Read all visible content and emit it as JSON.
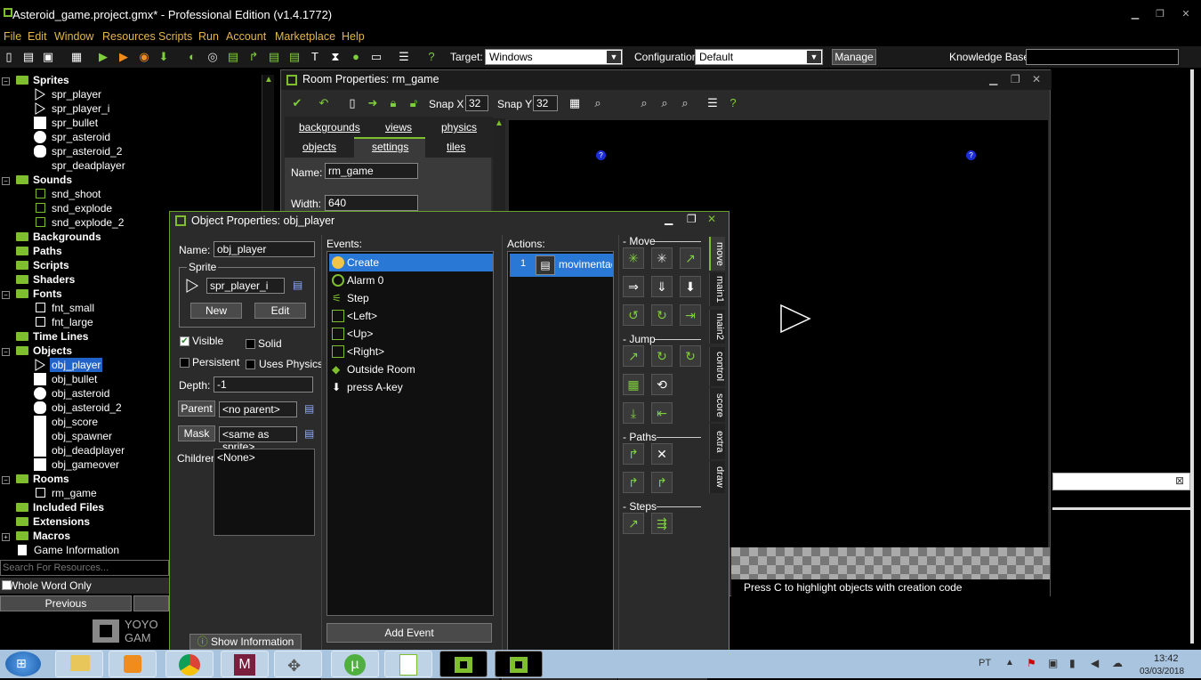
{
  "app": {
    "title": "Asteroid_game.project.gmx*  -  Professional Edition (v1.4.1772)",
    "win_minimize": "▁",
    "win_restore": "❐",
    "win_close": "✕"
  },
  "menu": [
    "File",
    "Edit",
    "Window",
    "Resources",
    "Scripts",
    "Run",
    "Account",
    "Marketplace",
    "Help"
  ],
  "toolbar": {
    "target_label": "Target:",
    "target_value": "Windows",
    "config_label": "Configuration:",
    "config_value": "Default",
    "manage_label": "Manage",
    "kb_label": "Knowledge Base:",
    "kb_value": ""
  },
  "tree": {
    "sprites": {
      "label": "Sprites",
      "items": [
        "spr_player",
        "spr_player_i",
        "spr_bullet",
        "spr_asteroid",
        "spr_asteroid_2",
        "spr_deadplayer"
      ]
    },
    "sounds": {
      "label": "Sounds",
      "items": [
        "snd_shoot",
        "snd_explode",
        "snd_explode_2"
      ]
    },
    "backgrounds": "Backgrounds",
    "paths": "Paths",
    "scripts": "Scripts",
    "shaders": "Shaders",
    "fonts": {
      "label": "Fonts",
      "items": [
        "fnt_small",
        "fnt_large"
      ]
    },
    "timelines": "Time Lines",
    "objects": {
      "label": "Objects",
      "items": [
        "obj_player",
        "obj_bullet",
        "obj_asteroid",
        "obj_asteroid_2",
        "obj_score",
        "obj_spawner",
        "obj_deadplayer",
        "obj_gameover"
      ]
    },
    "rooms": {
      "label": "Rooms",
      "items": [
        "rm_game"
      ]
    },
    "included": "Included Files",
    "extensions": "Extensions",
    "macros": "Macros",
    "gameinfo": "Game Information",
    "search_placeholder": "Search For Resources...",
    "whole_word": "Whole Word Only",
    "previous": "Previous"
  },
  "room": {
    "title": "Room Properties: rm_game",
    "snapx_label": "Snap X",
    "snapx": "32",
    "snapy_label": "Snap Y",
    "snapy": "32",
    "tabs_top": [
      "backgrounds",
      "views",
      "physics"
    ],
    "tabs_bottom": [
      "objects",
      "settings",
      "tiles"
    ],
    "name_label": "Name:",
    "name_value": "rm_game",
    "width_label": "Width:",
    "width_value": "640",
    "hint": "Press C to highlight objects with creation code"
  },
  "obj": {
    "title": "Object Properties: obj_player",
    "name_label": "Name:",
    "name_value": "obj_player",
    "sprite_label": "Sprite",
    "sprite_value": "spr_player_i",
    "new_label": "New",
    "edit_label": "Edit",
    "visible_label": "Visible",
    "solid_label": "Solid",
    "persistent_label": "Persistent",
    "physics_label": "Uses Physics",
    "depth_label": "Depth:",
    "depth_value": "-1",
    "parent_label": "Parent",
    "parent_value": "<no parent>",
    "mask_label": "Mask",
    "mask_value": "<same as sprite>",
    "children_label": "Children:",
    "children_value": "<None>",
    "show_info": "Show Information",
    "events_label": "Events:",
    "events": [
      "Create",
      "Alarm 0",
      "Step",
      "<Left>",
      "<Up>",
      "<Right>",
      "Outside Room",
      "press A-key"
    ],
    "add_event": "Add Event",
    "actions_label": "Actions:",
    "action_num": "1",
    "action_text": "movimentaç",
    "sections": {
      "move": "Move",
      "jump": "Jump",
      "paths": "Paths",
      "steps": "Steps"
    },
    "vtabs": [
      "move",
      "main1",
      "main2",
      "control",
      "score",
      "extra",
      "draw"
    ]
  },
  "taskbar": {
    "lang": "PT",
    "time": "13:42",
    "date": "03/03/2018"
  },
  "brand": {
    "logo_text_1": "YOYO",
    "logo_text_2": "GAM"
  },
  "colors": {
    "accent_green": "#7fbf2f",
    "menu_orange": "#e5b64d",
    "selection_blue": "#2a78d6"
  }
}
